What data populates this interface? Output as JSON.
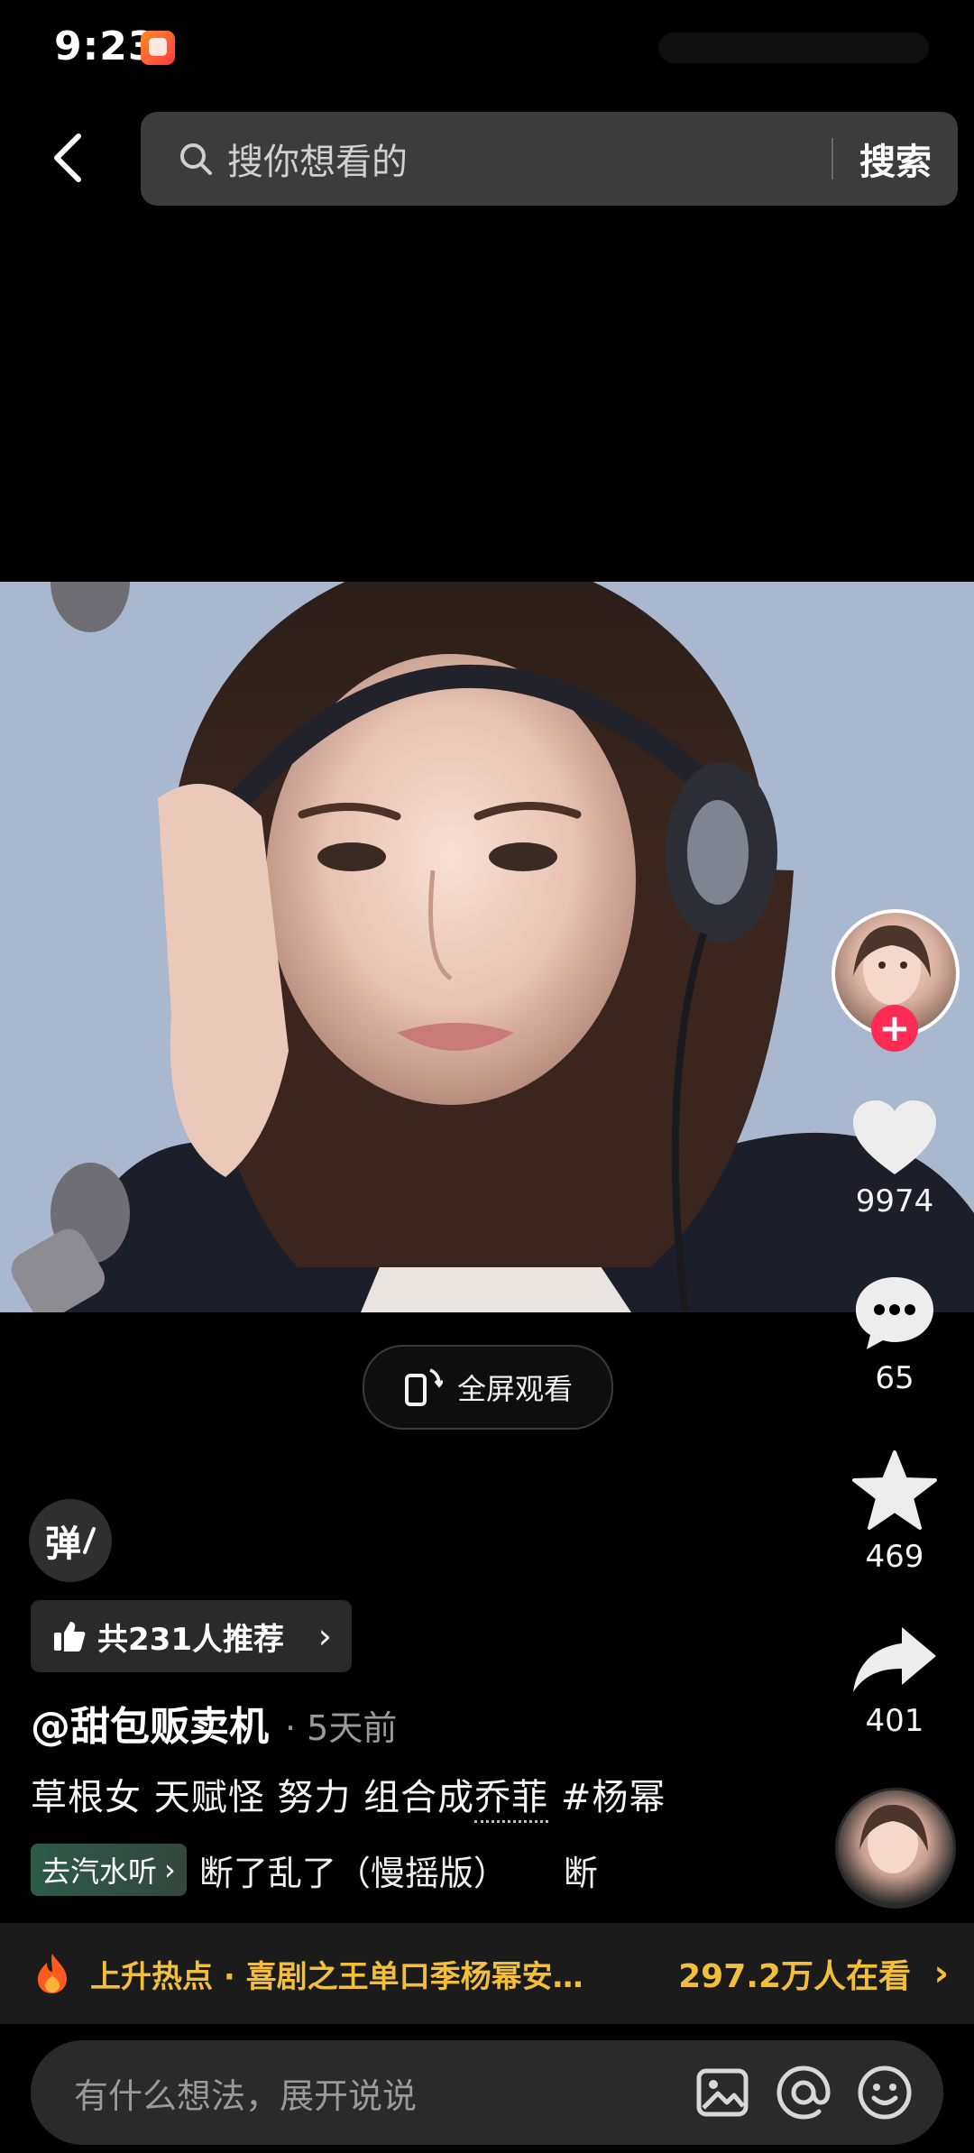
{
  "status_bar": {
    "time": "9:23"
  },
  "search": {
    "placeholder": "搜你想看的",
    "button_label": "搜索"
  },
  "player": {
    "fullscreen_label": "全屏观看"
  },
  "actions": {
    "likes": "9974",
    "comments": "65",
    "favorites": "469",
    "shares": "401",
    "follow_symbol": "+"
  },
  "danmaku": {
    "label": "弹"
  },
  "recommend": {
    "label": "共231人推荐"
  },
  "post": {
    "author": "@甜包贩卖机",
    "time": "· 5天前",
    "caption_part1": "草根女 天赋怪 努力 组合成",
    "caption_link": "乔菲",
    "caption_tag": " #杨幂"
  },
  "music": {
    "tag_label": "去汽水听",
    "title": "断了乱了（慢摇版）",
    "title_scroll": "断"
  },
  "hot": {
    "label": "上升热点 · 喜剧之王单口季杨幂安…",
    "count": "297.2万人在看"
  },
  "comment": {
    "placeholder": "有什么想法，展开说说"
  },
  "colors": {
    "accent_red": "#fe2c55",
    "hot_gold": "#f3bf3a"
  }
}
